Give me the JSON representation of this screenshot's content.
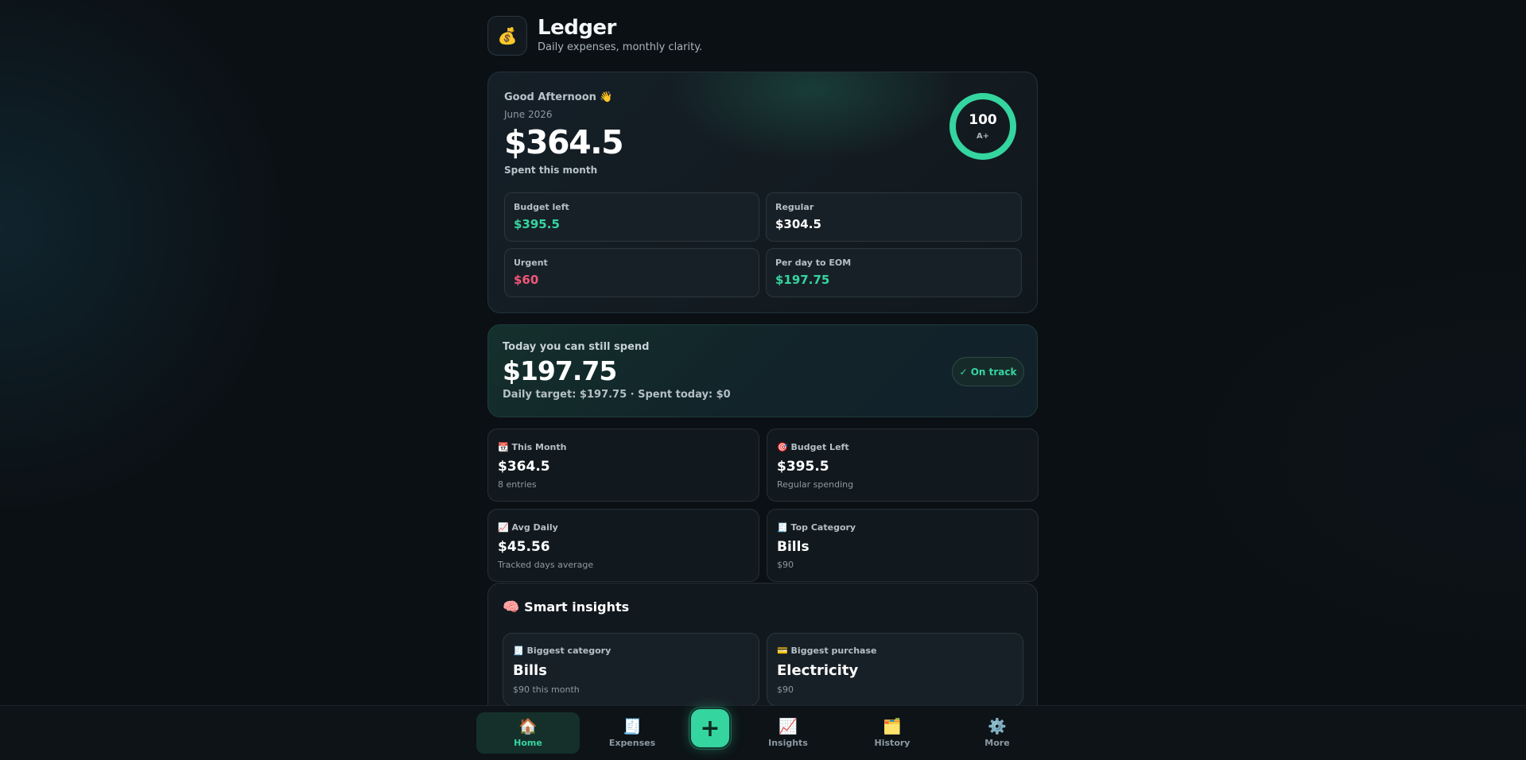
{
  "app": {
    "icon": "💰",
    "title": "Ledger",
    "subtitle": "Daily expenses, monthly clarity."
  },
  "hero": {
    "greeting": "Good Afternoon 👋",
    "month": "June 2026",
    "amount": "$364.5",
    "caption": "Spent this month",
    "score": "100",
    "grade": "A+",
    "score_fraction": 1.0,
    "stats": [
      {
        "label": "Budget left",
        "value": "$395.5",
        "tone": "green"
      },
      {
        "label": "Regular",
        "value": "$304.5",
        "tone": "white"
      },
      {
        "label": "Urgent",
        "value": "$60",
        "tone": "red"
      },
      {
        "label": "Per day to EOM",
        "value": "$197.75",
        "tone": "green"
      }
    ]
  },
  "today": {
    "label": "Today you can still spend",
    "amount": "$197.75",
    "sub": "Daily target: $197.75 · Spent today: $0",
    "badge": "✓ On track"
  },
  "metrics": [
    {
      "icon": "📆",
      "label": "This Month",
      "value": "$364.5",
      "sub": "8 entries"
    },
    {
      "icon": "🎯",
      "label": "Budget Left",
      "value": "$395.5",
      "sub": "Regular spending"
    },
    {
      "icon": "📈",
      "label": "Avg Daily",
      "value": "$45.56",
      "sub": "Tracked days average"
    },
    {
      "icon": "🧾",
      "label": "Top Category",
      "value": "Bills",
      "sub": "$90"
    }
  ],
  "insights": {
    "icon": "🧠",
    "title": "Smart insights",
    "cards": [
      {
        "icon": "🧾",
        "label": "Biggest category",
        "value": "Bills",
        "sub": "$90 this month"
      },
      {
        "icon": "💳",
        "label": "Biggest purchase",
        "value": "Electricity",
        "sub": "$90"
      }
    ]
  },
  "nav": {
    "items": [
      {
        "icon": "🏠",
        "label": "Home",
        "active": true
      },
      {
        "icon": "🧾",
        "label": "Expenses"
      },
      {
        "icon": "📈",
        "label": "Insights"
      },
      {
        "icon": "🗂️",
        "label": "History"
      },
      {
        "icon": "⚙️",
        "label": "More"
      }
    ],
    "add": "+"
  },
  "colors": {
    "accent": "#35d59f",
    "danger": "#f0577a",
    "background": "#0b1014"
  }
}
